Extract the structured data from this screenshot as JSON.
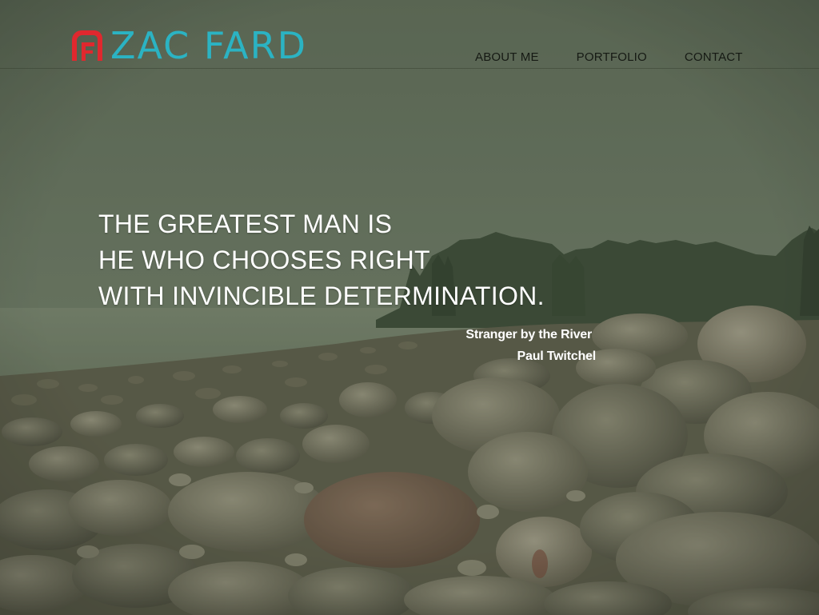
{
  "brand": {
    "name": "ZAC FARD",
    "logo_colors": {
      "mark": "#e0282e",
      "text": "#2bb3c3"
    }
  },
  "nav": {
    "items": [
      {
        "label": "ABOUT ME"
      },
      {
        "label": "PORTFOLIO"
      },
      {
        "label": "CONTACT"
      }
    ]
  },
  "hero": {
    "quote_lines": [
      "THE GREATEST MAN IS",
      "HE WHO CHOOSES RIGHT",
      "WITH INVINCIBLE DETERMINATION."
    ],
    "source_title": "Stranger by the River",
    "source_author": "Paul Twitchel",
    "background": "rocky-shoreline-photo"
  },
  "colors": {
    "quote_text": "#ffffff",
    "nav_text": "#161a14",
    "tint": "#5d6a56"
  }
}
